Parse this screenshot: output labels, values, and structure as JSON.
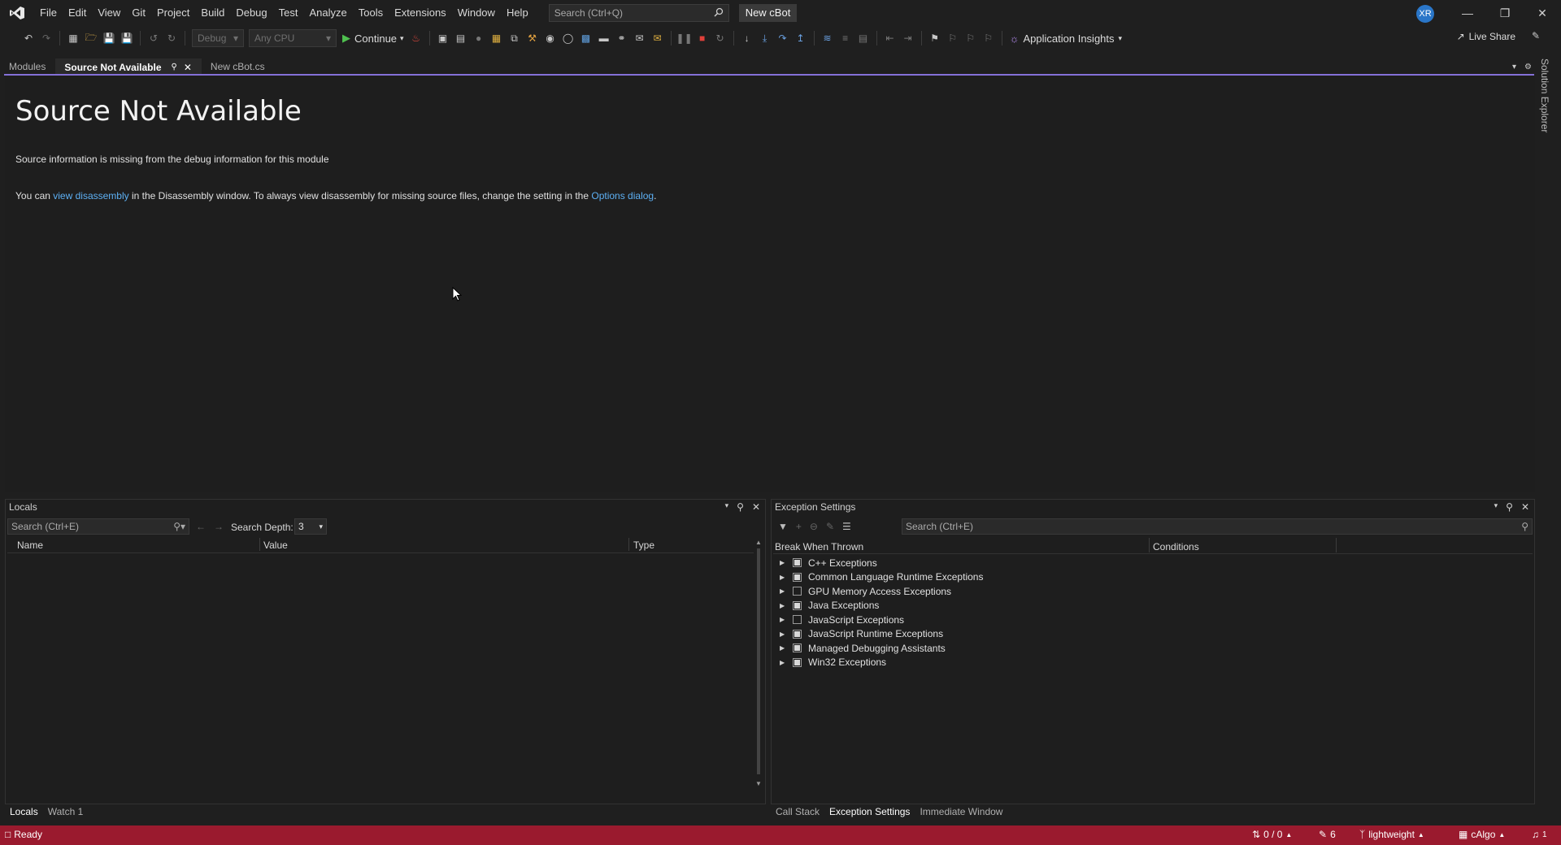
{
  "menubar": {
    "items": [
      "File",
      "Edit",
      "View",
      "Git",
      "Project",
      "Build",
      "Debug",
      "Test",
      "Analyze",
      "Tools",
      "Extensions",
      "Window",
      "Help"
    ],
    "search_placeholder": "Search (Ctrl+Q)",
    "solution_name": "New cBot",
    "avatar_initials": "XR"
  },
  "toolbar": {
    "config": "Debug",
    "platform": "Any CPU",
    "continue_label": "Continue",
    "app_insights_label": "Application Insights",
    "live_share_label": "Live Share"
  },
  "doc_tabs": [
    {
      "label": "Modules",
      "active": false
    },
    {
      "label": "Source Not Available",
      "active": true
    },
    {
      "label": "New cBot.cs",
      "active": false
    }
  ],
  "document": {
    "title": "Source Not Available",
    "message": "Source information is missing from the debug information for this module",
    "help_prefix": "You can ",
    "help_link1": "view disassembly",
    "help_middle": " in the Disassembly window. To always view disassembly for missing source files, change the setting in the ",
    "help_link2": "Options dialog",
    "help_suffix": "."
  },
  "side_strip": {
    "solution_explorer_label": "Solution Explorer"
  },
  "locals": {
    "title": "Locals",
    "search_placeholder": "Search (Ctrl+E)",
    "search_depth_label": "Search Depth:",
    "search_depth_value": "3",
    "columns": [
      "Name",
      "Value",
      "Type"
    ],
    "bottom_tabs": [
      {
        "label": "Locals",
        "active": true
      },
      {
        "label": "Watch 1",
        "active": false
      }
    ]
  },
  "exceptions": {
    "title": "Exception Settings",
    "search_placeholder": "Search (Ctrl+E)",
    "columns": [
      "Break When Thrown",
      "Conditions"
    ],
    "rows": [
      {
        "label": "C++ Exceptions",
        "state": "partial"
      },
      {
        "label": "Common Language Runtime Exceptions",
        "state": "partial"
      },
      {
        "label": "GPU Memory Access Exceptions",
        "state": "unchecked"
      },
      {
        "label": "Java Exceptions",
        "state": "partial"
      },
      {
        "label": "JavaScript Exceptions",
        "state": "unchecked"
      },
      {
        "label": "JavaScript Runtime Exceptions",
        "state": "partial"
      },
      {
        "label": "Managed Debugging Assistants",
        "state": "partial"
      },
      {
        "label": "Win32 Exceptions",
        "state": "partial"
      }
    ],
    "bottom_tabs": [
      {
        "label": "Call Stack",
        "active": false
      },
      {
        "label": "Exception Settings",
        "active": true
      },
      {
        "label": "Immediate Window",
        "active": false
      }
    ]
  },
  "statusbar": {
    "ready": "Ready",
    "changes": "0 / 0",
    "edits": "6",
    "branch": "lightweight",
    "repo": "cAlgo",
    "notifications": "1"
  },
  "colors": {
    "status_bar": "#9a1a2e",
    "accent": "#8470d8",
    "link": "#5db0f4"
  }
}
